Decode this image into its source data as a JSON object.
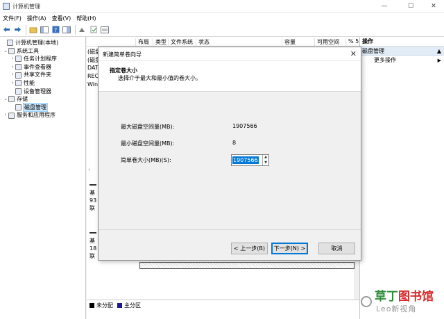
{
  "window": {
    "title": "计算机管理",
    "minimize_glyph": "—",
    "maximize_glyph": "☐",
    "close_glyph": "✕"
  },
  "menu": [
    "文件(F)",
    "操作(A)",
    "查看(V)",
    "帮助(H)"
  ],
  "toolbar_icons": [
    "back-arrow-icon",
    "forward-arrow-icon",
    "up-folder-icon",
    "show-tree-icon",
    "help-icon",
    "properties-icon",
    "console-icon",
    "export-icon",
    "refresh-icon"
  ],
  "tree": [
    {
      "label": "计算机管理(本地)",
      "level": 0,
      "caret": "",
      "icon": "computer-management-icon"
    },
    {
      "label": "系统工具",
      "level": 1,
      "caret": "⌄",
      "icon": "tools-icon"
    },
    {
      "label": "任务计划程序",
      "level": 2,
      "caret": "›",
      "icon": "task-scheduler-icon"
    },
    {
      "label": "事件查看器",
      "level": 2,
      "caret": "›",
      "icon": "event-viewer-icon"
    },
    {
      "label": "共享文件夹",
      "level": 2,
      "caret": "›",
      "icon": "shared-folder-icon"
    },
    {
      "label": "性能",
      "level": 2,
      "caret": "›",
      "icon": "performance-icon"
    },
    {
      "label": "设备管理器",
      "level": 2,
      "caret": "",
      "icon": "device-manager-icon"
    },
    {
      "label": "存储",
      "level": 1,
      "caret": "⌄",
      "icon": "storage-icon"
    },
    {
      "label": "磁盘管理",
      "level": 2,
      "caret": "",
      "icon": "disk-management-icon",
      "selected": true
    },
    {
      "label": "服务和应用程序",
      "level": 1,
      "caret": "›",
      "icon": "services-icon"
    }
  ],
  "columns": [
    "布局",
    "类型",
    "文件系统",
    "状态",
    "容量",
    "可用空间",
    "% 5"
  ],
  "volume_fragments": [
    "(磁盘",
    "(磁盘",
    "DAT",
    "REC",
    "Win"
  ],
  "disk_blocks": [
    {
      "lines": [
        "基",
        "93",
        "联"
      ]
    },
    {
      "lines": [
        "基",
        "18",
        "联"
      ]
    }
  ],
  "legend": [
    {
      "label": "未分配",
      "color": "#000000"
    },
    {
      "label": "主分区",
      "color": "#1a1a8c"
    }
  ],
  "actions": {
    "title": "操作",
    "section": "磁盘管理",
    "section_arrow": "▲",
    "items": [
      {
        "label": "更多操作",
        "arrow": "▶"
      }
    ]
  },
  "wizard": {
    "title": "新建简单卷向导",
    "close_glyph": "✕",
    "header_title": "指定卷大小",
    "header_subtitle": "选择介于最大和最小值的卷大小。",
    "fields": [
      {
        "label": "最大磁盘空间量(MB):",
        "value": "1907566"
      },
      {
        "label": "最小磁盘空间量(MB):",
        "value": "8"
      }
    ],
    "size_label": "简单卷大小(MB)(S):",
    "size_value": "1907566",
    "buttons": {
      "back": "< 上一步(B)",
      "next": "下一步(N) >",
      "cancel": "取消"
    }
  },
  "watermark": {
    "main_green": "草丁",
    "main_red": "图书馆",
    "sub": "Leo新视角"
  }
}
